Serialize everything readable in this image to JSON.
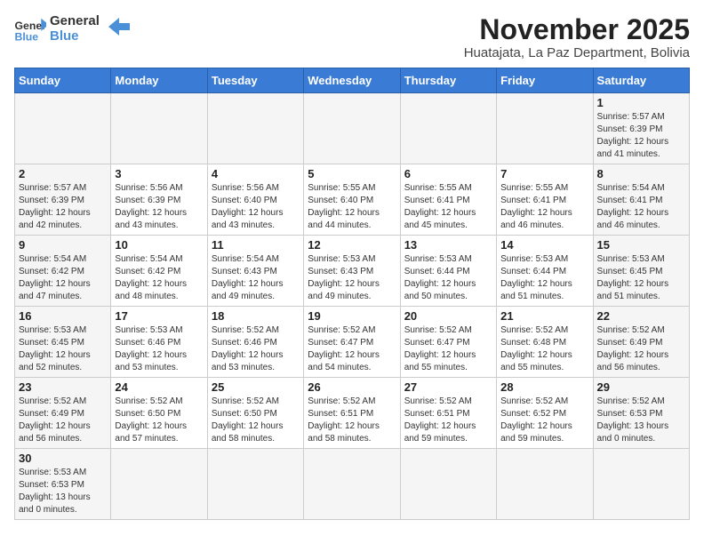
{
  "header": {
    "logo_general": "General",
    "logo_blue": "Blue",
    "month_year": "November 2025",
    "location": "Huatajata, La Paz Department, Bolivia"
  },
  "weekdays": [
    "Sunday",
    "Monday",
    "Tuesday",
    "Wednesday",
    "Thursday",
    "Friday",
    "Saturday"
  ],
  "weeks": [
    [
      {
        "day": "",
        "info": ""
      },
      {
        "day": "",
        "info": ""
      },
      {
        "day": "",
        "info": ""
      },
      {
        "day": "",
        "info": ""
      },
      {
        "day": "",
        "info": ""
      },
      {
        "day": "",
        "info": ""
      },
      {
        "day": "1",
        "info": "Sunrise: 5:57 AM\nSunset: 6:39 PM\nDaylight: 12 hours\nand 41 minutes."
      }
    ],
    [
      {
        "day": "2",
        "info": "Sunrise: 5:57 AM\nSunset: 6:39 PM\nDaylight: 12 hours\nand 42 minutes."
      },
      {
        "day": "3",
        "info": "Sunrise: 5:56 AM\nSunset: 6:39 PM\nDaylight: 12 hours\nand 43 minutes."
      },
      {
        "day": "4",
        "info": "Sunrise: 5:56 AM\nSunset: 6:40 PM\nDaylight: 12 hours\nand 43 minutes."
      },
      {
        "day": "5",
        "info": "Sunrise: 5:55 AM\nSunset: 6:40 PM\nDaylight: 12 hours\nand 44 minutes."
      },
      {
        "day": "6",
        "info": "Sunrise: 5:55 AM\nSunset: 6:41 PM\nDaylight: 12 hours\nand 45 minutes."
      },
      {
        "day": "7",
        "info": "Sunrise: 5:55 AM\nSunset: 6:41 PM\nDaylight: 12 hours\nand 46 minutes."
      },
      {
        "day": "8",
        "info": "Sunrise: 5:54 AM\nSunset: 6:41 PM\nDaylight: 12 hours\nand 46 minutes."
      }
    ],
    [
      {
        "day": "9",
        "info": "Sunrise: 5:54 AM\nSunset: 6:42 PM\nDaylight: 12 hours\nand 47 minutes."
      },
      {
        "day": "10",
        "info": "Sunrise: 5:54 AM\nSunset: 6:42 PM\nDaylight: 12 hours\nand 48 minutes."
      },
      {
        "day": "11",
        "info": "Sunrise: 5:54 AM\nSunset: 6:43 PM\nDaylight: 12 hours\nand 49 minutes."
      },
      {
        "day": "12",
        "info": "Sunrise: 5:53 AM\nSunset: 6:43 PM\nDaylight: 12 hours\nand 49 minutes."
      },
      {
        "day": "13",
        "info": "Sunrise: 5:53 AM\nSunset: 6:44 PM\nDaylight: 12 hours\nand 50 minutes."
      },
      {
        "day": "14",
        "info": "Sunrise: 5:53 AM\nSunset: 6:44 PM\nDaylight: 12 hours\nand 51 minutes."
      },
      {
        "day": "15",
        "info": "Sunrise: 5:53 AM\nSunset: 6:45 PM\nDaylight: 12 hours\nand 51 minutes."
      }
    ],
    [
      {
        "day": "16",
        "info": "Sunrise: 5:53 AM\nSunset: 6:45 PM\nDaylight: 12 hours\nand 52 minutes."
      },
      {
        "day": "17",
        "info": "Sunrise: 5:53 AM\nSunset: 6:46 PM\nDaylight: 12 hours\nand 53 minutes."
      },
      {
        "day": "18",
        "info": "Sunrise: 5:52 AM\nSunset: 6:46 PM\nDaylight: 12 hours\nand 53 minutes."
      },
      {
        "day": "19",
        "info": "Sunrise: 5:52 AM\nSunset: 6:47 PM\nDaylight: 12 hours\nand 54 minutes."
      },
      {
        "day": "20",
        "info": "Sunrise: 5:52 AM\nSunset: 6:47 PM\nDaylight: 12 hours\nand 55 minutes."
      },
      {
        "day": "21",
        "info": "Sunrise: 5:52 AM\nSunset: 6:48 PM\nDaylight: 12 hours\nand 55 minutes."
      },
      {
        "day": "22",
        "info": "Sunrise: 5:52 AM\nSunset: 6:49 PM\nDaylight: 12 hours\nand 56 minutes."
      }
    ],
    [
      {
        "day": "23",
        "info": "Sunrise: 5:52 AM\nSunset: 6:49 PM\nDaylight: 12 hours\nand 56 minutes."
      },
      {
        "day": "24",
        "info": "Sunrise: 5:52 AM\nSunset: 6:50 PM\nDaylight: 12 hours\nand 57 minutes."
      },
      {
        "day": "25",
        "info": "Sunrise: 5:52 AM\nSunset: 6:50 PM\nDaylight: 12 hours\nand 58 minutes."
      },
      {
        "day": "26",
        "info": "Sunrise: 5:52 AM\nSunset: 6:51 PM\nDaylight: 12 hours\nand 58 minutes."
      },
      {
        "day": "27",
        "info": "Sunrise: 5:52 AM\nSunset: 6:51 PM\nDaylight: 12 hours\nand 59 minutes."
      },
      {
        "day": "28",
        "info": "Sunrise: 5:52 AM\nSunset: 6:52 PM\nDaylight: 12 hours\nand 59 minutes."
      },
      {
        "day": "29",
        "info": "Sunrise: 5:52 AM\nSunset: 6:53 PM\nDaylight: 13 hours\nand 0 minutes."
      }
    ],
    [
      {
        "day": "30",
        "info": "Sunrise: 5:53 AM\nSunset: 6:53 PM\nDaylight: 13 hours\nand 0 minutes."
      },
      {
        "day": "",
        "info": ""
      },
      {
        "day": "",
        "info": ""
      },
      {
        "day": "",
        "info": ""
      },
      {
        "day": "",
        "info": ""
      },
      {
        "day": "",
        "info": ""
      },
      {
        "day": "",
        "info": ""
      }
    ]
  ]
}
